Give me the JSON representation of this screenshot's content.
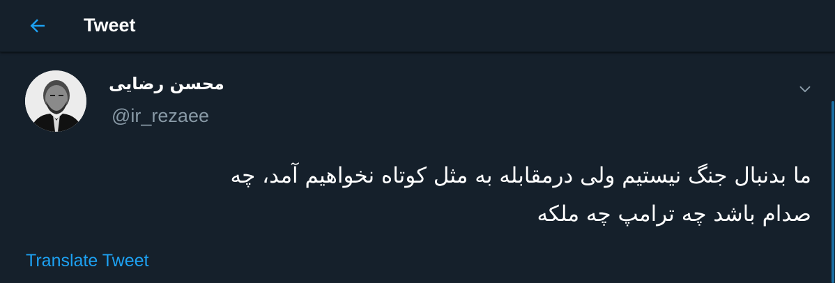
{
  "header": {
    "back_icon": "arrow-left-icon",
    "title": "Tweet"
  },
  "tweet": {
    "author_name": "محسن رضایی",
    "author_handle": "@ir_rezaee",
    "avatar_icon": "user-avatar",
    "menu_icon": "chevron-down-icon",
    "body_line_1": "ما بدنبال جنگ نیستیم ولی درمقابله به مثل کوتاه نخواهیم آمد، چه",
    "body_line_2": "صدام باشد چه ترامپ چه ملکه",
    "translate_label": "Translate Tweet"
  },
  "colors": {
    "background": "#15202b",
    "accent": "#1da1f2",
    "secondary_text": "#8899a6"
  }
}
